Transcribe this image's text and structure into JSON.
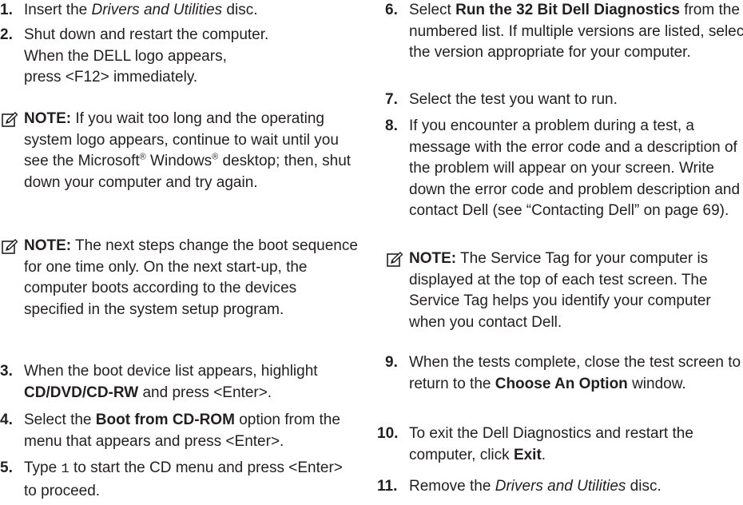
{
  "left_column": {
    "step1": {
      "num": "1.",
      "pre": "Insert the ",
      "em": "Drivers and Utilities",
      "post": " disc."
    },
    "step2": {
      "num": "2.",
      "line1": "Shut down and restart the computer.",
      "line2": "When the DELL logo appears, press <F12> immediately."
    },
    "note1": {
      "label": "NOTE:",
      "pre": " If you wait too long and the operating system logo appears, continue to wait until you see the Microsoft",
      "reg1": "®",
      "mid": " Windows",
      "reg2": "®",
      "post": " desktop; then, shut down your computer and try again."
    },
    "note2": {
      "label": "NOTE:",
      "text": " The next steps change the boot sequence for one time only. On the next start-up, the computer boots according to the devices specified in the system setup program."
    },
    "step3": {
      "num": "3.",
      "pre": "When the boot device list appears, highlight ",
      "bold": "CD/DVD/CD-RW",
      "post": " and press <Enter>."
    },
    "step4": {
      "num": "4.",
      "pre": "Select the ",
      "bold": "Boot from CD-ROM",
      "post": " option from the menu that appears and press <Enter>."
    },
    "step5": {
      "num": "5.",
      "pre": "Type ",
      "code": "1",
      "post": " to start the CD menu and press <Enter> to proceed."
    }
  },
  "right_column": {
    "step6": {
      "num": "6.",
      "pre": "Select ",
      "bold": "Run the 32 Bit Dell Diagnostics",
      "post": " from the numbered list. If multiple versions are listed, select the version appropriate for your computer."
    },
    "step7": {
      "num": "7.",
      "text": "Select the test you want to run."
    },
    "step8": {
      "num": "8.",
      "text": "If you encounter a problem during a test, a message with the error code and a description of the problem will appear on your screen. Write down the error code and problem description and contact Dell (see “Contacting Dell” on page 69)."
    },
    "note3": {
      "label": "NOTE:",
      "text": " The Service Tag for your computer is displayed at the top of each test screen. The Service Tag helps you identify your computer when you contact Dell."
    },
    "step9": {
      "num": "9.",
      "pre": "When the tests complete, close the test screen to return to the ",
      "bold": "Choose An Option",
      "post": " window."
    },
    "step10": {
      "num": "10.",
      "pre": "To exit the Dell Diagnostics and restart the computer, click ",
      "bold": "Exit",
      "post": "."
    },
    "step11": {
      "num": "11.",
      "pre": "Remove the ",
      "em": "Drivers and Utilities",
      "post": " disc."
    }
  },
  "colors": {
    "text": "#231f20",
    "icon": "#231f20"
  },
  "icons": {
    "note": "note-pencil-icon"
  }
}
